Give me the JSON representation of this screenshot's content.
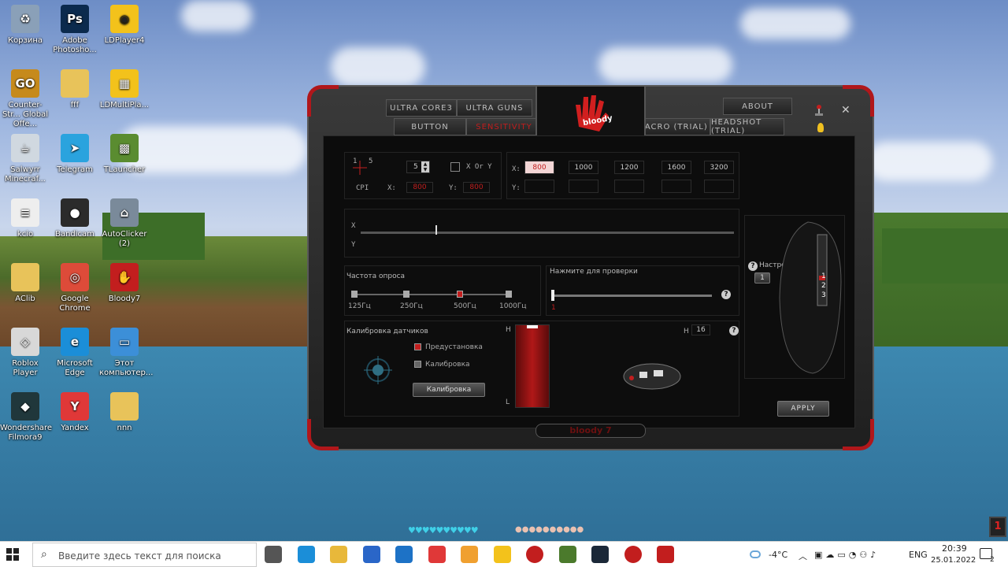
{
  "desktop": {
    "icons": [
      {
        "label": "Корзина",
        "icon": "recycle-bin-icon"
      },
      {
        "label": "Adobe Photosho...",
        "icon": "photoshop-icon"
      },
      {
        "label": "LDPlayer4",
        "icon": "ldplayer-icon"
      },
      {
        "label": "Counter-Str... Global Offe...",
        "icon": "csgo-icon"
      },
      {
        "label": "fff",
        "icon": "folder-icon"
      },
      {
        "label": "LDMultiPla...",
        "icon": "ldmultiplayer-icon"
      },
      {
        "label": "Salwyrr Minecraf...",
        "icon": "java-icon"
      },
      {
        "label": "Telegram",
        "icon": "telegram-icon"
      },
      {
        "label": "TLauncher",
        "icon": "tlauncher-icon"
      },
      {
        "label": "kcio",
        "icon": "document-icon"
      },
      {
        "label": "Bandicam",
        "icon": "bandicam-icon"
      },
      {
        "label": "AutoClicker (2)",
        "icon": "autoclicker-icon"
      },
      {
        "label": "AClib",
        "icon": "folder-icon"
      },
      {
        "label": "Google Chrome",
        "icon": "chrome-icon"
      },
      {
        "label": "Bloody7",
        "icon": "bloody-icon"
      },
      {
        "label": "Roblox Player",
        "icon": "roblox-icon"
      },
      {
        "label": "Microsoft Edge",
        "icon": "edge-icon"
      },
      {
        "label": "Этот компьютер...",
        "icon": "this-pc-icon"
      },
      {
        "label": "Wondershare Filmora9",
        "icon": "filmora-icon"
      },
      {
        "label": "Yandex",
        "icon": "yandex-icon"
      },
      {
        "label": "nnn",
        "icon": "folder-icon"
      }
    ]
  },
  "bloody": {
    "tabs": {
      "ultra_core": "ULTRA CORE3",
      "ultra_guns": "ULTRA GUNS",
      "button": "BUTTON",
      "sensitivity": "SENSITIVITY",
      "about": "ABOUT",
      "macro": "MACRO (TRIAL)",
      "headshot": "HEADSHOT (TRIAL)"
    },
    "logo_text": "bloody",
    "cpi": {
      "step_marks": [
        "1",
        "5"
      ],
      "stepper_value": "5",
      "xory_label": "X Or Y",
      "cpi_label": "CPI",
      "x_label": "X:",
      "x_value": "800",
      "y_label": "Y:",
      "y_value": "800",
      "row_x_label": "X:",
      "row_y_label": "Y:",
      "presets": [
        "800",
        "1000",
        "1200",
        "1600",
        "3200"
      ],
      "active_preset": "800"
    },
    "slider_axes": {
      "x": "X",
      "y": "Y",
      "x_level": 0.2
    },
    "polling": {
      "title": "Частота опроса",
      "options": [
        "125Гц",
        "250Гц",
        "500Гц",
        "1000Гц"
      ],
      "selected": "500Гц"
    },
    "test": {
      "title": "Нажмите для проверки",
      "marker": "1"
    },
    "calibration": {
      "title": "Калибровка датчиков",
      "preset": "Предустановка",
      "calibrate": "Калибровка",
      "button": "Калибровка",
      "high": "H",
      "low": "L",
      "level_h": "H",
      "level_value": "16"
    },
    "cpi_settings": {
      "label": "Настройки CPI",
      "value": "1",
      "mouse_marks": [
        "1",
        "2",
        "3"
      ]
    },
    "apply": "APPLY",
    "footer_logo": "bloody 7"
  },
  "game_hud": {
    "hearts": "♥♥♥♥♥♥♥♥♥♥",
    "food": "●●●●●●●●●●"
  },
  "taskbar": {
    "search_placeholder": "Введите здесь текст для поиска",
    "weather": "-4°C",
    "lang": "ENG",
    "time": "20:39",
    "date": "25.01.2022",
    "notif_count": "2",
    "apps": [
      "task-view-icon",
      "edge-icon",
      "explorer-icon",
      "store-icon",
      "mail-icon",
      "yandex-icon",
      "yandex-browser-icon",
      "ldplayer-icon",
      "record-icon",
      "minecraft-icon",
      "steam-icon",
      "bandicam-icon",
      "bloody-icon"
    ]
  }
}
